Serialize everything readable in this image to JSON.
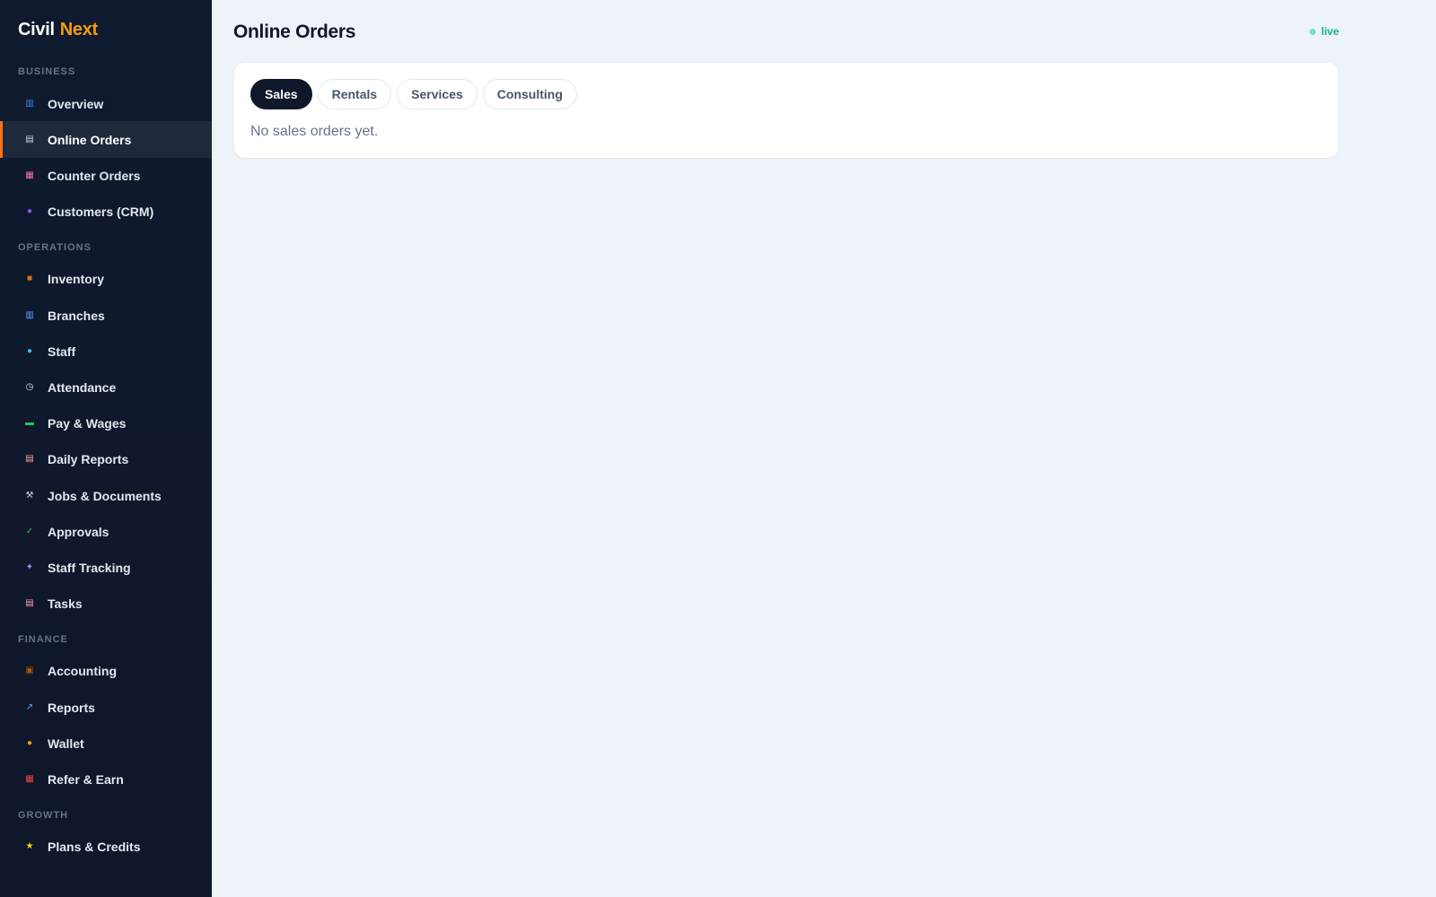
{
  "brand": {
    "part1": "Civil",
    "part2": "Next",
    "accent_color": "#f59e0b"
  },
  "sidebar": {
    "sections": [
      {
        "label": "BUSINESS",
        "items": [
          {
            "label": "Overview",
            "icon": "bar-chart-icon",
            "color": "#3b82f6",
            "glyph": "▥"
          },
          {
            "label": "Online Orders",
            "icon": "receipt-icon",
            "color": "#cbd5e1",
            "glyph": "▤",
            "active": true
          },
          {
            "label": "Counter Orders",
            "icon": "store-icon",
            "color": "#f472b6",
            "glyph": "▦"
          },
          {
            "label": "Customers (CRM)",
            "icon": "people-icon",
            "color": "#8b5cf6",
            "glyph": "●"
          }
        ]
      },
      {
        "label": "OPERATIONS",
        "items": [
          {
            "label": "Inventory",
            "icon": "package-icon",
            "color": "#d97706",
            "glyph": "■"
          },
          {
            "label": "Branches",
            "icon": "building-icon",
            "color": "#60a5fa",
            "glyph": "▥"
          },
          {
            "label": "Staff",
            "icon": "worker-icon",
            "color": "#38bdf8",
            "glyph": "●"
          },
          {
            "label": "Attendance",
            "icon": "clock-icon",
            "color": "#e2e8f0",
            "glyph": "◷"
          },
          {
            "label": "Pay & Wages",
            "icon": "money-icon",
            "color": "#22c55e",
            "glyph": "▬"
          },
          {
            "label": "Daily Reports",
            "icon": "memo-icon",
            "color": "#fca5a5",
            "glyph": "▤"
          },
          {
            "label": "Jobs & Documents",
            "icon": "wrench-icon",
            "color": "#cbd5e1",
            "glyph": "⚒"
          },
          {
            "label": "Approvals",
            "icon": "check-icon",
            "color": "#22c55e",
            "glyph": "✓"
          },
          {
            "label": "Staff Tracking",
            "icon": "satellite-icon",
            "color": "#a78bfa",
            "glyph": "✦"
          },
          {
            "label": "Tasks",
            "icon": "clipboard-icon",
            "color": "#fda4af",
            "glyph": "▤"
          }
        ]
      },
      {
        "label": "FINANCE",
        "items": [
          {
            "label": "Accounting",
            "icon": "briefcase-icon",
            "color": "#b45309",
            "glyph": "▣"
          },
          {
            "label": "Reports",
            "icon": "trend-chart-icon",
            "color": "#60a5fa",
            "glyph": "↗"
          },
          {
            "label": "Wallet",
            "icon": "money-bag-icon",
            "color": "#f59e0b",
            "glyph": "●"
          },
          {
            "label": "Refer & Earn",
            "icon": "gift-icon",
            "color": "#ef4444",
            "glyph": "▦"
          }
        ]
      },
      {
        "label": "GROWTH",
        "items": [
          {
            "label": "Plans & Credits",
            "icon": "star-icon",
            "color": "#facc15",
            "glyph": "★"
          }
        ]
      }
    ]
  },
  "main": {
    "title": "Online Orders",
    "status": "live",
    "status_color": "#10b981",
    "tabs": [
      {
        "label": "Sales",
        "active": true
      },
      {
        "label": "Rentals"
      },
      {
        "label": "Services"
      },
      {
        "label": "Consulting"
      }
    ],
    "empty_message": "No sales orders yet."
  }
}
